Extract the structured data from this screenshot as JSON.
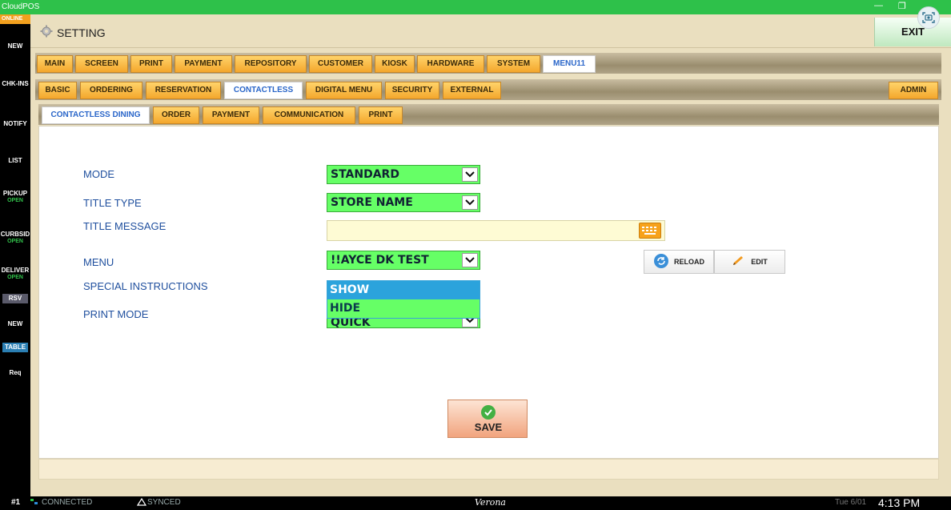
{
  "window": {
    "title": "CloudPOS",
    "minimize": "—",
    "restore": "❐",
    "close": "✕"
  },
  "sidebar": {
    "online": "ONLINE",
    "items": [
      {
        "label": "NEW",
        "sub": ""
      },
      {
        "label": "CHK-INS",
        "sub": ""
      },
      {
        "label": "NOTIFY",
        "sub": ""
      },
      {
        "label": "LIST",
        "sub": ""
      },
      {
        "label": "PICKUP",
        "sub": "OPEN"
      },
      {
        "label": "CURBSID",
        "sub": "OPEN"
      },
      {
        "label": "DELIVER",
        "sub": "OPEN"
      }
    ],
    "rsv": "RSV",
    "new2": "NEW",
    "table": "TABLE",
    "req": "Req"
  },
  "header": {
    "title": "SETTING",
    "exit": "EXIT"
  },
  "tabs_main": [
    "MAIN",
    "SCREEN",
    "PRINT",
    "PAYMENT",
    "REPOSITORY",
    "CUSTOMER",
    "KIOSK",
    "HARDWARE",
    "SYSTEM",
    "MENU11"
  ],
  "tabs_sub": [
    "BASIC",
    "ORDERING",
    "RESERVATION",
    "CONTACTLESS",
    "DIGITAL MENU",
    "SECURITY",
    "EXTERNAL"
  ],
  "tab_admin": "ADMIN",
  "tabs_third": [
    "CONTACTLESS DINING",
    "ORDER",
    "PAYMENT",
    "COMMUNICATION",
    "PRINT"
  ],
  "form": {
    "mode_label": "MODE",
    "mode_value": "STANDARD",
    "title_type_label": "TITLE TYPE",
    "title_type_value": "STORE NAME",
    "title_message_label": "TITLE MESSAGE",
    "title_message_value": "",
    "menu_label": "MENU",
    "menu_value": "!!AYCE DK TEST",
    "special_label": "SPECIAL INSTRUCTIONS",
    "print_mode_label": "PRINT MODE",
    "print_mode_value": "QUICK",
    "dropdown_options": [
      "SHOW",
      "HIDE"
    ],
    "reload": "RELOAD",
    "edit": "EDIT",
    "save": "SAVE"
  },
  "status": {
    "terminal": "#1",
    "connected": "CONNECTED",
    "synced": "SYNCED",
    "store": "Verona",
    "date": "Tue 6/01",
    "time": "4:13 PM"
  },
  "colors": {
    "select_green": "#66ff66",
    "active_tab_text": "#2a66c9",
    "label_blue": "#1f4f9e",
    "titlebar_green": "#2ec14a"
  }
}
